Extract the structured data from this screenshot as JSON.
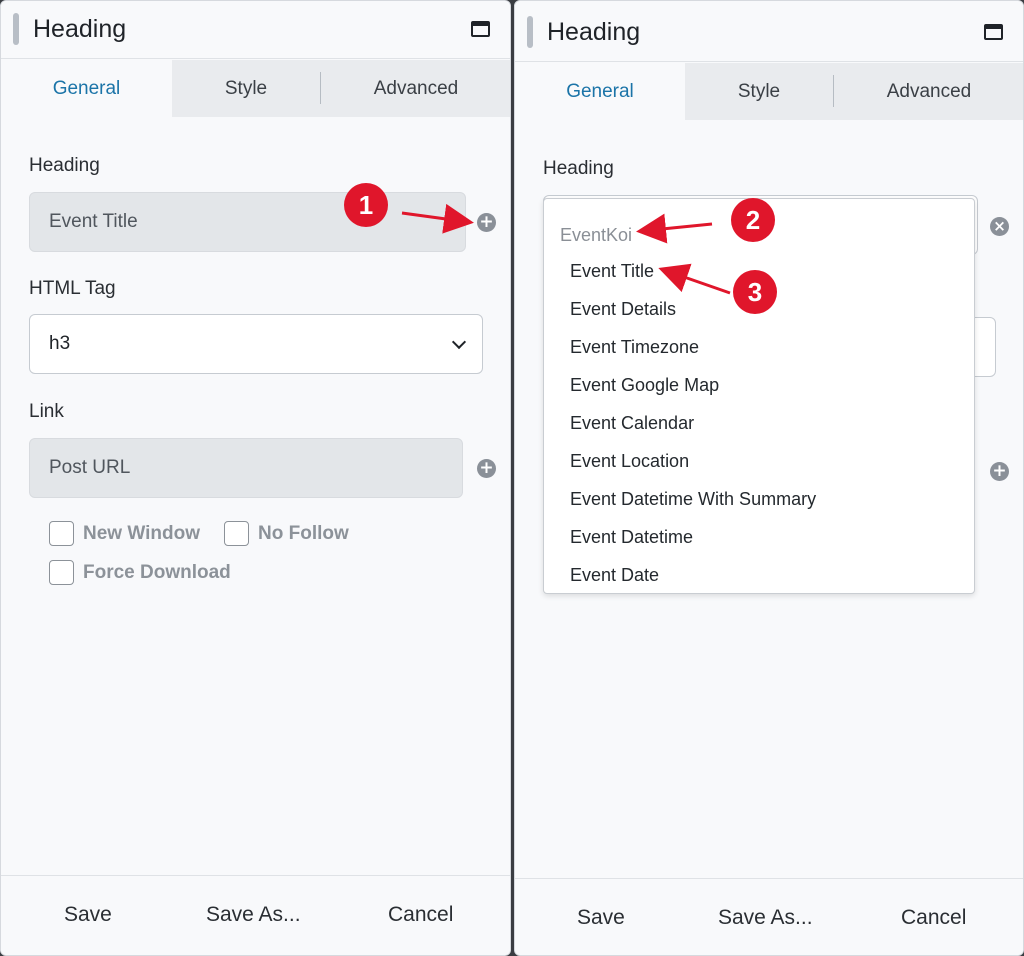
{
  "left_panel": {
    "title": "Heading",
    "tabs": [
      "General",
      "Style",
      "Advanced"
    ],
    "heading_label": "Heading",
    "heading_value": "Event Title",
    "html_tag_label": "HTML Tag",
    "html_tag_value": "h3",
    "link_label": "Link",
    "link_value": "Post URL",
    "checkboxes": [
      "New Window",
      "No Follow",
      "Force Download"
    ],
    "footer": [
      "Save",
      "Save As...",
      "Cancel"
    ]
  },
  "right_panel": {
    "title": "Heading",
    "tabs": [
      "General",
      "Style",
      "Advanced"
    ],
    "heading_label": "Heading",
    "dropdown": {
      "group_label": "EventKoi",
      "options": [
        "Event Title",
        "Event Details",
        "Event Timezone",
        "Event Google Map",
        "Event Calendar",
        "Event Location",
        "Event Datetime With Summary",
        "Event Datetime",
        "Event Date"
      ]
    },
    "footer": [
      "Save",
      "Save As...",
      "Cancel"
    ]
  },
  "annotations": [
    "1",
    "2",
    "3"
  ],
  "icons": {
    "add": "+",
    "clear": "×"
  },
  "colors": {
    "accent": "#1b74a8",
    "badge": "#e0162b"
  }
}
